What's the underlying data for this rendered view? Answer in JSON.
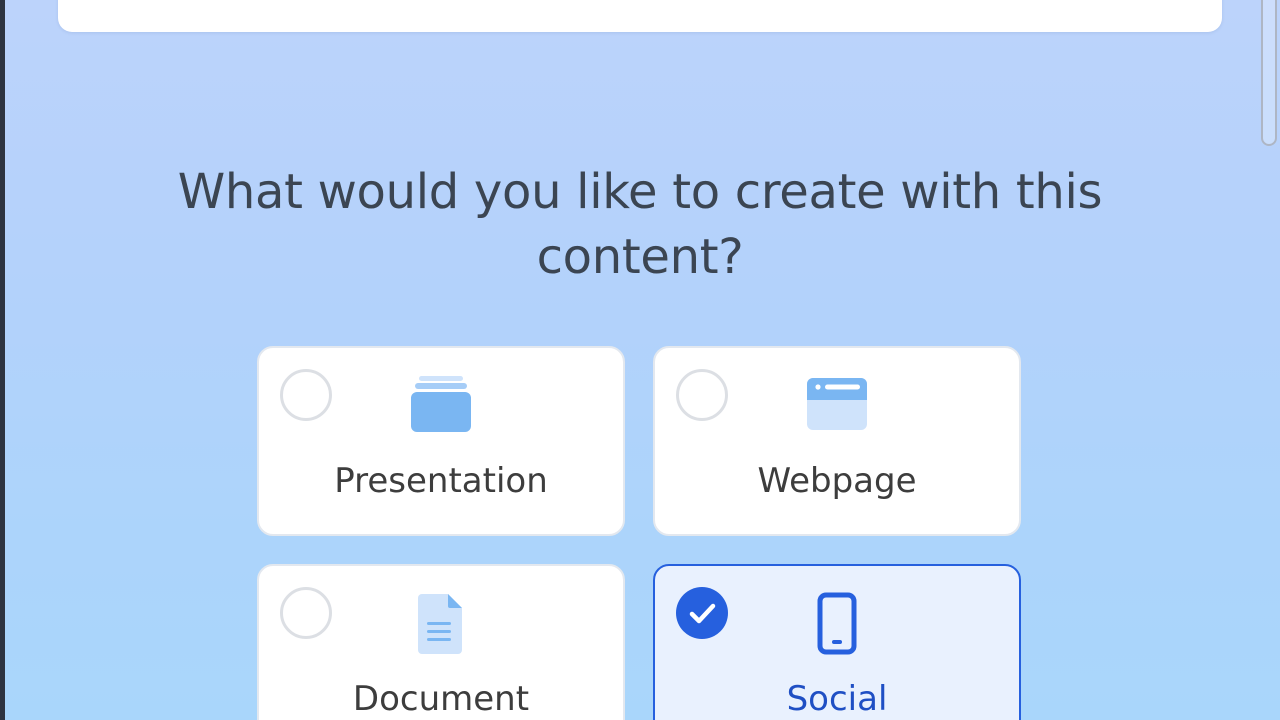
{
  "heading": "What would you like to create with this content?",
  "options": [
    {
      "label": "Presentation",
      "icon": "slides-icon",
      "selected": false
    },
    {
      "label": "Webpage",
      "icon": "browser-window-icon",
      "selected": false
    },
    {
      "label": "Document",
      "icon": "document-icon",
      "selected": false
    },
    {
      "label": "Social",
      "icon": "smartphone-icon",
      "selected": true
    }
  ],
  "colors": {
    "accent": "#2660de",
    "icon_light": "#7ab6f2",
    "heading_text": "#3b4552"
  }
}
